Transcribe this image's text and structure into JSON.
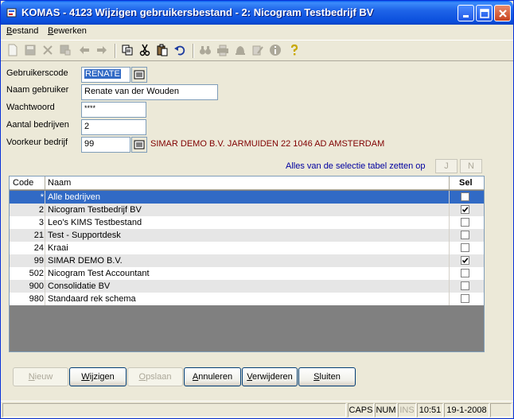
{
  "window": {
    "title": "KOMAS - 4123 Wijzigen gebruikersbestand - 2: Nicogram Testbedrijf BV"
  },
  "menu": [
    {
      "underline": "B",
      "rest": "estand"
    },
    {
      "underline": "B",
      "rest": "ewerken"
    }
  ],
  "form": {
    "user_code_label": "Gebruikerscode",
    "user_code_value": "RENATE",
    "user_name_label": "Naam gebruiker",
    "user_name_value": "Renate van der Wouden",
    "password_label": "Wachtwoord",
    "password_value": "****",
    "company_count_label": "Aantal bedrijven",
    "company_count_value": "2",
    "pref_company_label": "Voorkeur bedrijf",
    "pref_company_value": "99",
    "pref_company_info": "SIMAR DEMO B.V. JARMUIDEN 22 1046 AD AMSTERDAM"
  },
  "selection": {
    "label": "Alles van de selectie tabel zetten op",
    "yes_label": "J",
    "no_label": "N"
  },
  "table": {
    "headers": {
      "code": "Code",
      "name": "Naam",
      "sel": "Sel"
    },
    "rows": [
      {
        "code": "*",
        "name": "Alle bedrijven",
        "checked": false
      },
      {
        "code": "2",
        "name": "Nicogram Testbedrijf BV",
        "checked": true
      },
      {
        "code": "3",
        "name": "Leo's KIMS Testbestand",
        "checked": false
      },
      {
        "code": "21",
        "name": "Test - Supportdesk",
        "checked": false
      },
      {
        "code": "24",
        "name": "Kraai",
        "checked": false
      },
      {
        "code": "99",
        "name": "SIMAR DEMO B.V.",
        "checked": true
      },
      {
        "code": "502",
        "name": "Nicogram Test Accountant",
        "checked": false
      },
      {
        "code": "900",
        "name": "Consolidatie BV",
        "checked": false
      },
      {
        "code": "980",
        "name": "Standaard rek schema",
        "checked": false
      }
    ]
  },
  "buttons": {
    "new": {
      "u": "N",
      "rest": "ieuw"
    },
    "edit": {
      "u": "W",
      "rest": "ijzigen"
    },
    "save": {
      "u": "O",
      "rest": "pslaan"
    },
    "cancel": {
      "u": "A",
      "rest": "nnuleren"
    },
    "delete": {
      "u": "V",
      "rest": "erwijderen"
    },
    "close": {
      "u": "S",
      "rest": "luiten"
    }
  },
  "status": {
    "caps": "CAPS",
    "num": "NUM",
    "ins": "INS",
    "time": "10:51",
    "date": "19-1-2008"
  },
  "icons": [
    "window-icon",
    "minimize-icon",
    "maximize-icon",
    "close-icon",
    "new-doc-icon",
    "save-icon",
    "delete-icon",
    "save-as-icon",
    "back-icon",
    "forward-icon",
    "copy-icon",
    "cut-icon",
    "paste-icon",
    "undo-icon",
    "binoculars-icon",
    "print-icon",
    "bell-icon",
    "edit-icon",
    "info-icon",
    "help-icon",
    "lookup-icon",
    "checkbox-check-icon"
  ]
}
